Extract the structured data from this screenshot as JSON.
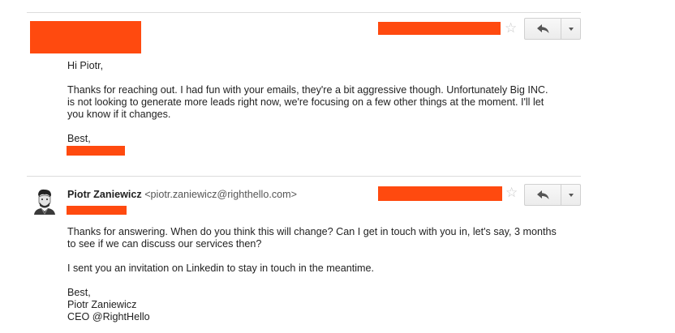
{
  "colors": {
    "redaction": "#ff4a0f",
    "divider": "#dcdcdc",
    "text": "#222222"
  },
  "message1": {
    "greeting": "Hi Piotr,",
    "paragraph": [
      "Thanks for reaching out. I had fun with your emails, they're a bit aggressive though. Unfortunately Big INC.",
      "is not looking to generate more leads right now, we're focusing on a few other things at the moment. I'll let",
      "you know if it changes."
    ],
    "signoff": "Best,",
    "star_icon": "star-outline-icon",
    "reply_icon": "reply-icon",
    "more_icon": "chevron-down-icon"
  },
  "message2": {
    "sender_name": "Piotr Zaniewicz",
    "sender_email": "<piotr.zaniewicz@righthello.com>",
    "paragraph1": [
      "Thanks for answering. When do you think this will change? Can I get in touch with you in, let's say, 3 months",
      "to see if we can discuss our services then?"
    ],
    "paragraph2": "I sent you an invitation on Linkedin to stay in touch in the meantime.",
    "signature": [
      "Best,",
      "Piotr Zaniewicz",
      "CEO @RightHello"
    ],
    "star_icon": "star-outline-icon",
    "reply_icon": "reply-icon",
    "more_icon": "chevron-down-icon",
    "avatar_icon": "avatar-icon"
  }
}
